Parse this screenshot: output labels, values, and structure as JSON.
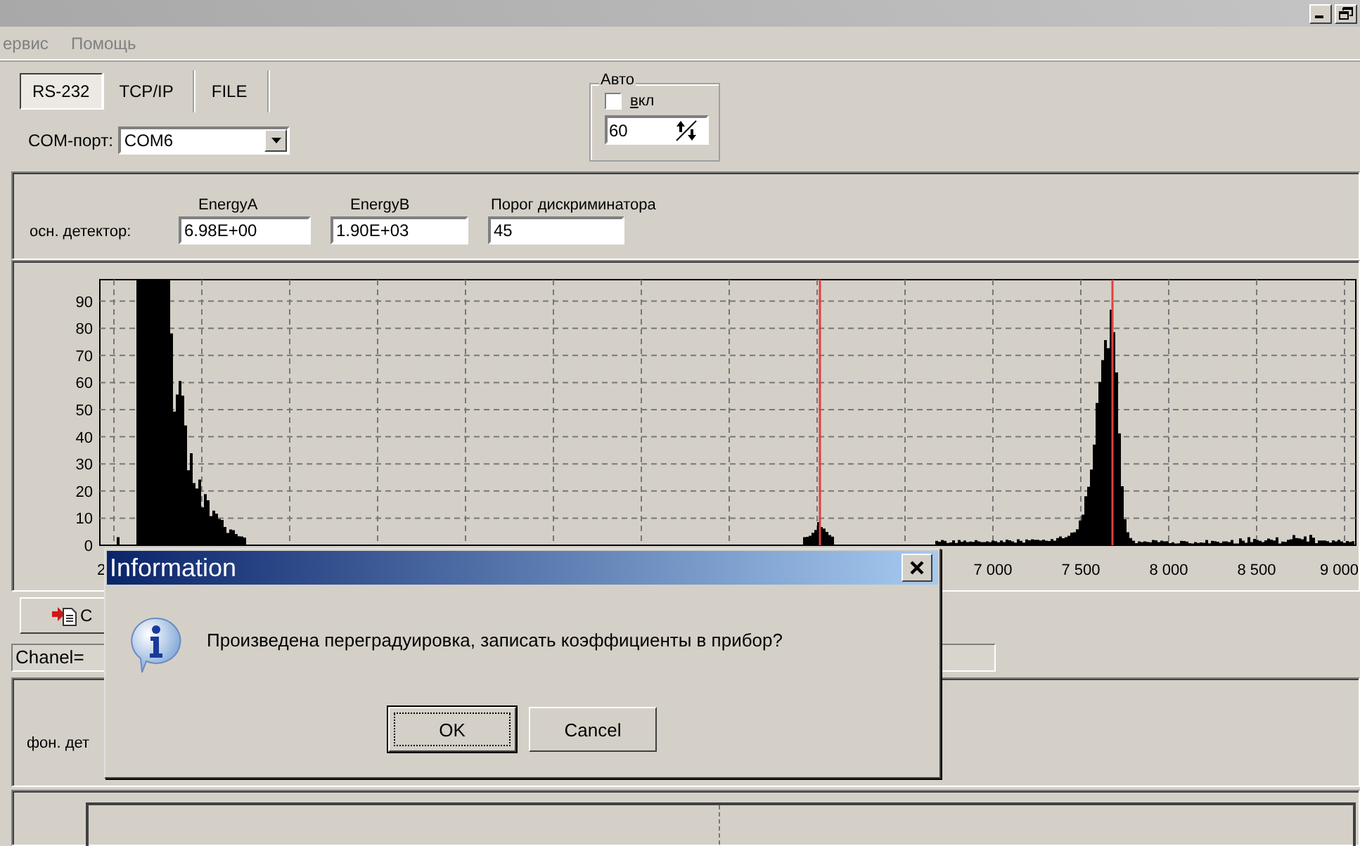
{
  "window": {
    "buttons": [
      {
        "kind": "minimize"
      },
      {
        "kind": "restore"
      }
    ]
  },
  "menu": [
    {
      "label": "ервис"
    },
    {
      "label": "Помощь"
    }
  ],
  "tabs": [
    {
      "label": "RS-232",
      "selected": true
    },
    {
      "label": "TCP/IP",
      "selected": false
    },
    {
      "label": "FILE",
      "selected": false
    }
  ],
  "com_port": {
    "label": "COM-порт:",
    "value": "COM6"
  },
  "auto": {
    "title": "Авто",
    "checkbox": {
      "label": "вкл",
      "checked": false
    },
    "interval": "60"
  },
  "detector": {
    "label": "осн. детектор:",
    "fields": [
      {
        "label": "EnergyA",
        "value": "6.98E+00"
      },
      {
        "label": "EnergyB",
        "value": "1.90E+03"
      },
      {
        "label": "Порог дискриминатора",
        "value": "45"
      }
    ]
  },
  "chart": {
    "y_ticks": [
      "90",
      "80",
      "70",
      "60",
      "50",
      "40",
      "30",
      "20",
      "10",
      "0"
    ],
    "x_ticks": [
      "2",
      "7 000",
      "7 500",
      "8 000",
      "8 500",
      "9 000"
    ]
  },
  "toolbar_button": {
    "label": "С"
  },
  "channel_field": {
    "value": "Chanel="
  },
  "background_detector": {
    "label": "фон. дет"
  },
  "dialog": {
    "title": "Information",
    "message": "Произведена переградуировка, записать коэффициенты в прибор?",
    "buttons": [
      {
        "label": "OK",
        "focused": true
      },
      {
        "label": "Cancel",
        "focused": false
      }
    ]
  }
}
